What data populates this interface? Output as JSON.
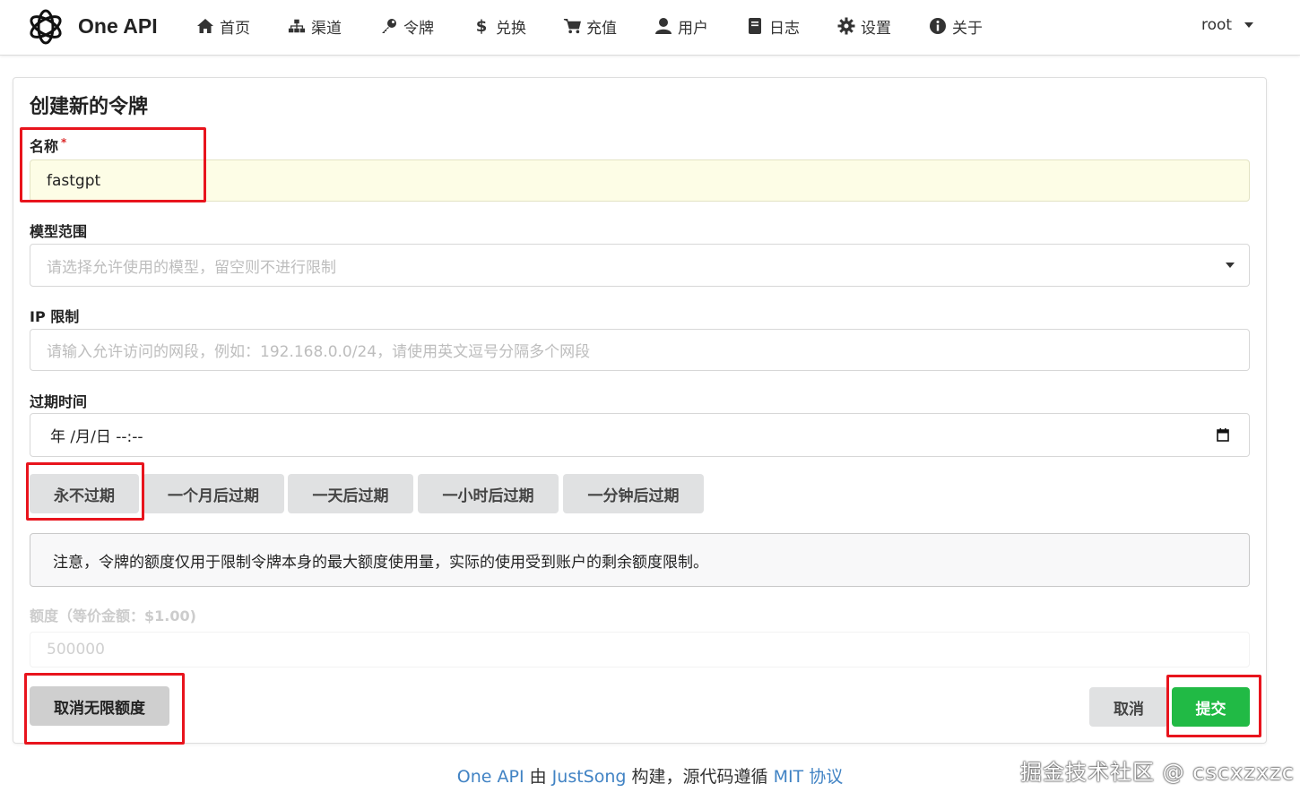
{
  "brand": "One API",
  "nav": [
    {
      "label": "首页",
      "icon": "home-icon"
    },
    {
      "label": "渠道",
      "icon": "sitemap-icon"
    },
    {
      "label": "令牌",
      "icon": "key-icon"
    },
    {
      "label": "兑换",
      "icon": "dollar-icon"
    },
    {
      "label": "充值",
      "icon": "cart-icon"
    },
    {
      "label": "用户",
      "icon": "user-icon"
    },
    {
      "label": "日志",
      "icon": "book-icon"
    },
    {
      "label": "设置",
      "icon": "gear-icon"
    },
    {
      "label": "关于",
      "icon": "info-icon"
    }
  ],
  "user": "root",
  "form": {
    "title": "创建新的令牌",
    "name_label": "名称",
    "required_mark": "*",
    "name_value": "fastgpt",
    "models_label": "模型范围",
    "models_placeholder": "请选择允许使用的模型，留空则不进行限制",
    "ip_label": "IP 限制",
    "ip_placeholder": "请输入允许访问的网段，例如：192.168.0.0/24，请使用英文逗号分隔多个网段",
    "expire_label": "过期时间",
    "expire_value": "年 /月/日 --:--",
    "expire_buttons": [
      "永不过期",
      "一个月后过期",
      "一天后过期",
      "一小时后过期",
      "一分钟后过期"
    ],
    "notice": "注意，令牌的额度仅用于限制令牌本身的最大额度使用量，实际的使用受到账户的剩余额度限制。",
    "quota_label": "额度（等价金额：$1.00)",
    "quota_value": "500000",
    "unlimited_button": "取消无限额度",
    "cancel_button": "取消",
    "submit_button": "提交"
  },
  "footer": {
    "brand_link": "One API",
    "by": " 由 ",
    "author_link": "JustSong",
    "built": " 构建，源代码遵循 ",
    "license_link": "MIT 协议"
  },
  "watermark": "掘金技术社区 @ cscxzxzc",
  "colors": {
    "accent_green": "#21ba45",
    "highlight_red": "#e8141d",
    "link_blue": "#4183c4"
  }
}
